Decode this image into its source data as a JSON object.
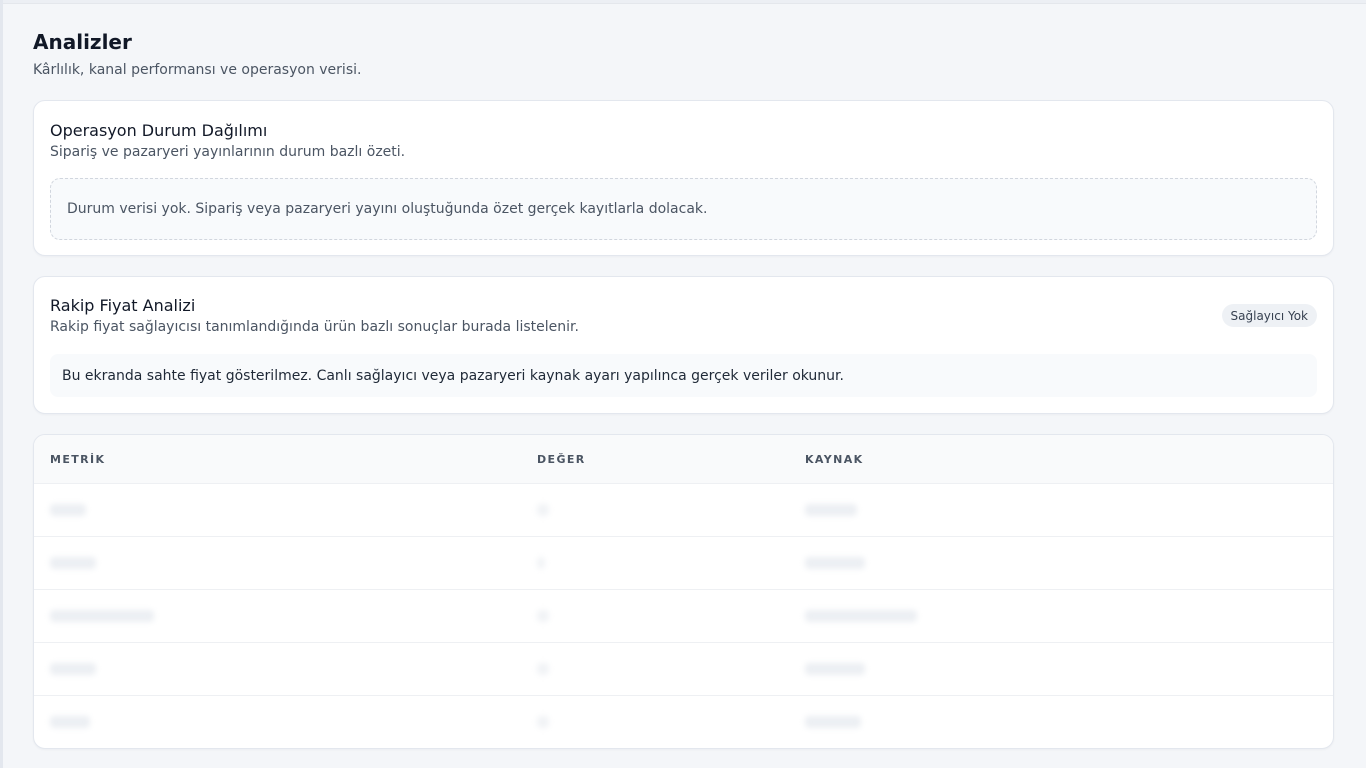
{
  "page": {
    "title": "Analizler",
    "subtitle": "Kârlılık, kanal performansı ve operasyon verisi."
  },
  "status_card": {
    "title": "Operasyon Durum Dağılımı",
    "description": "Sipariş ve pazaryeri yayınlarının durum bazlı özeti.",
    "empty_message": "Durum verisi yok. Sipariş veya pazaryeri yayını oluştuğunda özet gerçek kayıtlarla dolacak."
  },
  "rival_card": {
    "title": "Rakip Fiyat Analizi",
    "description": "Rakip fiyat sağlayıcısı tanımlandığında ürün bazlı sonuçlar burada listelenir.",
    "badge": "Sağlayıcı Yok",
    "notice": "Bu ekranda sahte fiyat gösterilmez. Canlı sağlayıcı veya pazaryeri kaynak ayarı yapılınca gerçek veriler okunur."
  },
  "metrics_table": {
    "columns": [
      "METRİK",
      "DEĞER",
      "KAYNAK"
    ],
    "row_count": 5
  },
  "colors": {
    "background": "#f4f6f9",
    "card": "#ffffff",
    "border": "#e3e7ee",
    "muted_text": "#4b5563"
  }
}
